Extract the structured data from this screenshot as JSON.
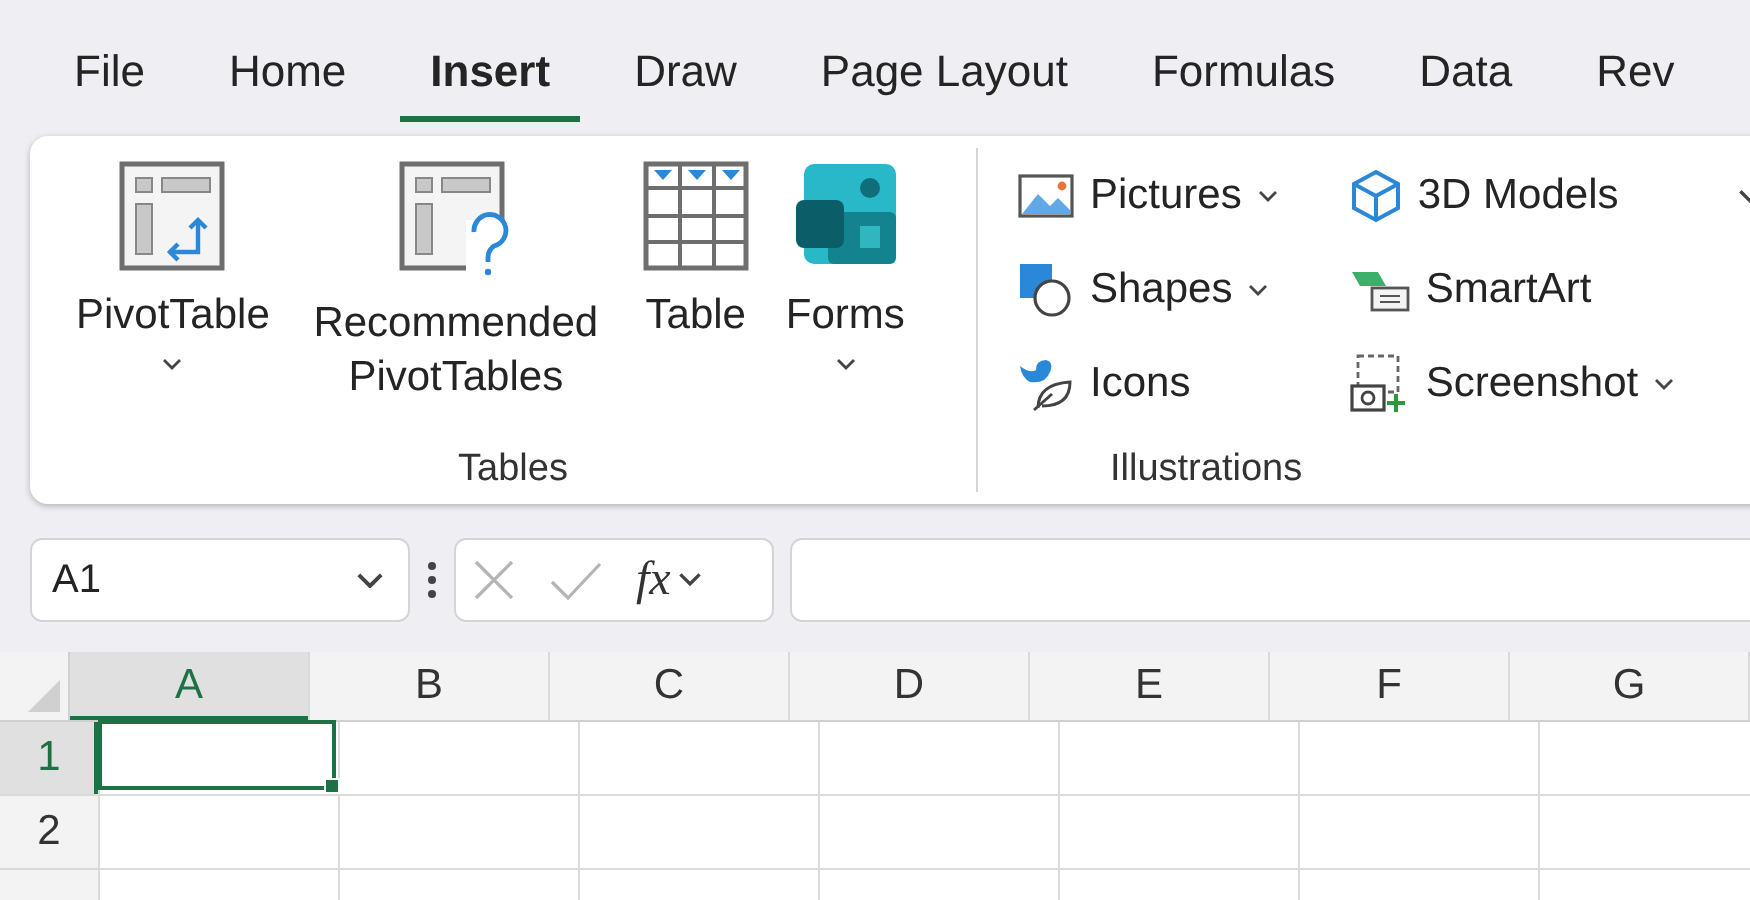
{
  "tabs": [
    {
      "label": "File",
      "selected": false
    },
    {
      "label": "Home",
      "selected": false
    },
    {
      "label": "Insert",
      "selected": true
    },
    {
      "label": "Draw",
      "selected": false
    },
    {
      "label": "Page Layout",
      "selected": false
    },
    {
      "label": "Formulas",
      "selected": false
    },
    {
      "label": "Data",
      "selected": false
    },
    {
      "label": "Rev",
      "selected": false
    }
  ],
  "ribbon": {
    "groups": [
      {
        "label": "Tables",
        "kind": "large",
        "buttons": [
          {
            "label": "PivotTable",
            "dropdown": true
          },
          {
            "label": "Recommended PivotTables",
            "dropdown": false
          },
          {
            "label": "Table",
            "dropdown": false
          },
          {
            "label": "Forms",
            "dropdown": true
          }
        ]
      },
      {
        "label": "Illustrations",
        "kind": "small",
        "more_menu": true,
        "buttons": [
          {
            "label": "Pictures",
            "dropdown": true
          },
          {
            "label": "Shapes",
            "dropdown": true
          },
          {
            "label": "Icons",
            "dropdown": false
          },
          {
            "label": "3D Models",
            "dropdown": false
          },
          {
            "label": "SmartArt",
            "dropdown": false
          },
          {
            "label": "Screenshot",
            "dropdown": true
          }
        ]
      }
    ]
  },
  "formula_bar": {
    "name_box": "A1",
    "function_label": "fx"
  },
  "sheet": {
    "columns": [
      {
        "label": "A",
        "selected": true
      },
      {
        "label": "B",
        "selected": false
      },
      {
        "label": "C",
        "selected": false
      },
      {
        "label": "D",
        "selected": false
      },
      {
        "label": "E",
        "selected": false
      },
      {
        "label": "F",
        "selected": false
      },
      {
        "label": "G",
        "selected": false
      }
    ],
    "rows": [
      {
        "label": "1",
        "selected": true
      },
      {
        "label": "2",
        "selected": false
      }
    ]
  }
}
